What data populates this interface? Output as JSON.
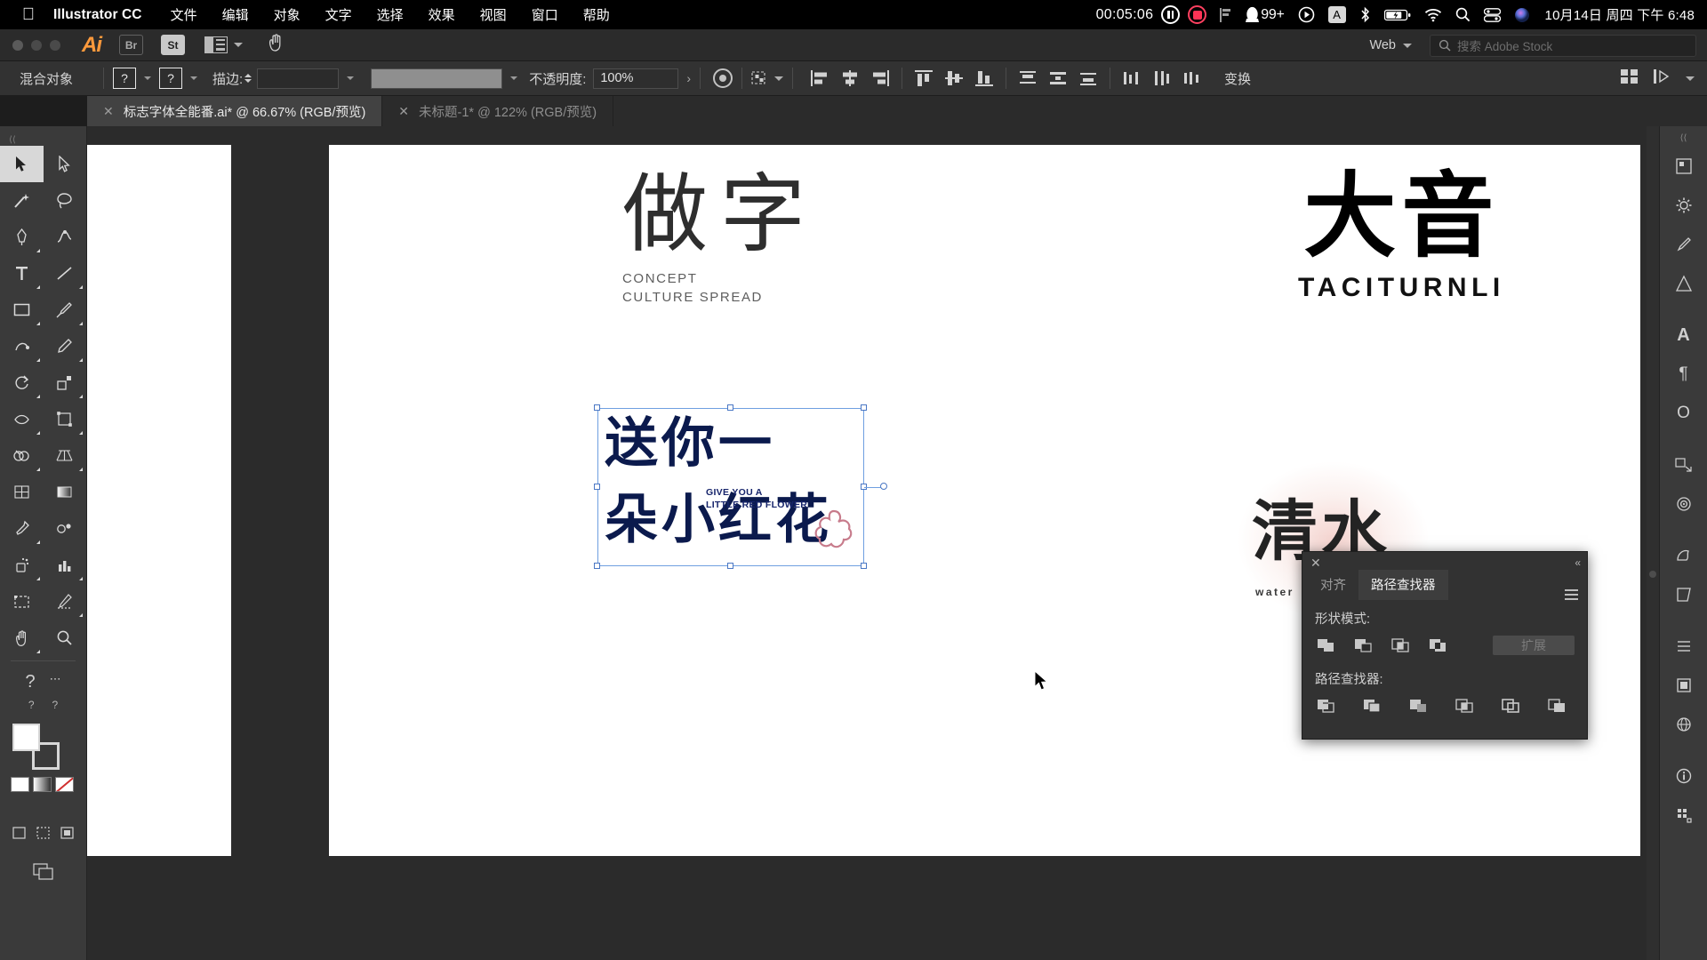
{
  "menubar": {
    "apple_icon": "apple-logo",
    "app_name": "Illustrator CC",
    "items": [
      "文件",
      "编辑",
      "对象",
      "文字",
      "选择",
      "效果",
      "视图",
      "窗口",
      "帮助"
    ],
    "recording_timer": "00:05:06",
    "pause_icon": "pause-icon",
    "record_icon": "record-icon",
    "flag_icon": "flag-icon",
    "qq_icon": "qq-penguin-icon",
    "notification_count": "99+",
    "play_icon": "play-circle-icon",
    "input_source": "A",
    "bluetooth_icon": "bluetooth-icon",
    "battery_icon": "battery-icon",
    "wifi_icon": "wifi-icon",
    "search_icon": "spotlight-search-icon",
    "control_center_icon": "control-center-icon",
    "siri_icon": "siri-icon",
    "clock": "10月14日 周四 下午 6:48"
  },
  "appbar": {
    "ai_logo": "Ai",
    "bridge_label": "Br",
    "stock_label": "St",
    "arrange_icon": "arrange-documents-icon",
    "hand_icon": "hand-tool-icon",
    "workspace": "Web",
    "search_placeholder": "搜索 Adobe Stock",
    "search_icon": "search-icon"
  },
  "controlbar": {
    "selection_label": "混合对象",
    "fill_value": "?",
    "stroke_value": "?",
    "stroke_label": "描边:",
    "stroke_weight": "",
    "opacity_label": "不透明度:",
    "opacity_value": "100%",
    "style_icon": "graphic-style-icon",
    "select_similar_icon": "select-similar-icon",
    "transform_label": "变换",
    "align_icons": [
      "align-left-icon",
      "align-center-h-icon",
      "align-right-icon",
      "align-top-icon",
      "align-center-v-icon",
      "align-bottom-icon",
      "distribute-top-icon",
      "distribute-center-v-icon",
      "distribute-bottom-icon",
      "distribute-left-icon",
      "distribute-center-h-icon",
      "distribute-right-icon"
    ],
    "right_icons": [
      "arrange-grid-icon",
      "flow-icon"
    ]
  },
  "tabs": [
    {
      "title": "标志字体全能番.ai* @ 66.67% (RGB/预览)",
      "active": true,
      "close_icon": "close-icon"
    },
    {
      "title": "未标题-1* @ 122% (RGB/预览)",
      "active": false,
      "close_icon": "close-icon"
    }
  ],
  "toolpanel": {
    "grip": "⟨⟨",
    "tools": [
      "selection-tool",
      "direct-selection-tool",
      "magic-wand-tool",
      "lasso-tool",
      "pen-tool",
      "curvature-tool",
      "type-tool",
      "line-segment-tool",
      "rectangle-tool",
      "paintbrush-tool",
      "shaper-tool",
      "pencil-tool",
      "rotate-tool",
      "scale-tool",
      "width-tool",
      "free-transform-tool",
      "shape-builder-tool",
      "perspective-grid-tool",
      "mesh-tool",
      "gradient-tool",
      "eyedropper-tool",
      "blend-tool",
      "symbol-sprayer-tool",
      "column-graph-tool",
      "artboard-tool",
      "slice-tool",
      "hand-tool",
      "zoom-tool"
    ],
    "selected_tool": "selection-tool",
    "fill_swatch": "#ffffff",
    "stroke_swatch": "none",
    "screen_mode_icon": "screen-mode-icon"
  },
  "canvas": {
    "artworks": [
      {
        "name": "zuozi-logo",
        "mark": "做字",
        "sub_line1": "CONCEPT",
        "sub_line2": "CULTURE SPREAD"
      },
      {
        "name": "dayin-logo",
        "mark": "大音",
        "sub": "TACITURNLI"
      },
      {
        "name": "selected-artwork",
        "line1": "送你一",
        "line2": "朵小红花",
        "en_line1": "GIVE YOU A",
        "en_line2": "LITTLE RED FLOWER",
        "accent_color": "#0b1a4d",
        "flower_color": "#c77b8b",
        "selected": true
      },
      {
        "name": "qingshui-logo",
        "mark": "清水",
        "sub": "water",
        "halo_color": "#ecb0a8"
      }
    ],
    "cursor_icon": "arrow-cursor",
    "selection_color": "#6f9fe0"
  },
  "pathfinder_panel": {
    "close_icon": "close-icon",
    "collapse_icon": "collapse-panel-icon",
    "menu_icon": "panel-menu-icon",
    "tabs": [
      {
        "label": "对齐",
        "active": false
      },
      {
        "label": "路径查找器",
        "active": true
      }
    ],
    "shape_modes_label": "形状模式:",
    "shape_mode_icons": [
      "unite-icon",
      "minus-front-icon",
      "intersect-icon",
      "exclude-icon"
    ],
    "expand_label": "扩展",
    "pathfinders_label": "路径查找器:",
    "pathfinder_icons": [
      "divide-icon",
      "trim-icon",
      "merge-icon",
      "crop-icon",
      "outline-icon",
      "minus-back-icon"
    ]
  },
  "rightdock": {
    "grip": "⟨⟨",
    "icons": [
      "color-panel-icon",
      "gear-panel-icon",
      "brushes-panel-icon",
      "symbols-panel-icon",
      "character-panel-icon",
      "paragraph-panel-icon",
      "opentype-panel-icon",
      "transform-panel-icon",
      "appearance-panel-icon",
      "graphic-styles-panel-icon",
      "artboards-panel-icon",
      "layers-panel-icon",
      "artboard-list-icon",
      "links-panel-icon",
      "info-panel-icon",
      "asset-export-panel-icon"
    ]
  }
}
